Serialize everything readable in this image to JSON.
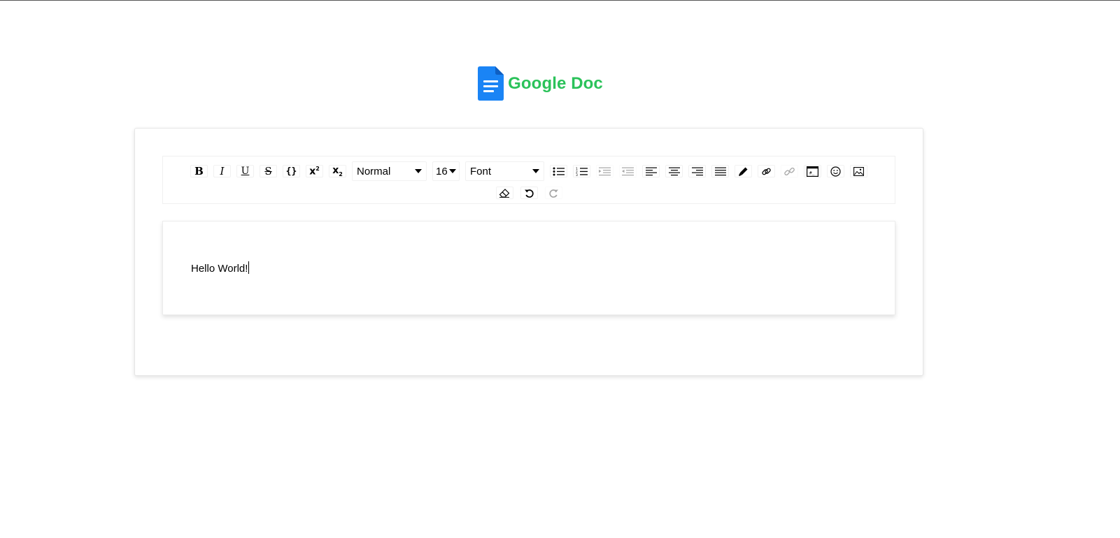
{
  "app": {
    "title": "Google Doc",
    "title_color": "#2bc25a",
    "logo_color": "#1a84f5"
  },
  "toolbar": {
    "buttons_row1_left": [
      {
        "name": "bold-button",
        "icon": "bold-icon",
        "glyph": "B"
      },
      {
        "name": "italic-button",
        "icon": "italic-icon",
        "glyph": "I"
      },
      {
        "name": "underline-button",
        "icon": "underline-icon",
        "glyph": "U"
      },
      {
        "name": "strikethrough-button",
        "icon": "strikethrough-icon",
        "glyph": "S"
      },
      {
        "name": "code-button",
        "icon": "code-braces-icon",
        "glyph": "{ }"
      },
      {
        "name": "superscript-button",
        "icon": "superscript-icon",
        "glyph": "x²"
      },
      {
        "name": "subscript-button",
        "icon": "subscript-icon",
        "glyph": "x₂"
      }
    ],
    "block_type": "Normal",
    "font_size": "16",
    "font_family": "Font",
    "buttons_row1_right": [
      "unordered-list-icon",
      "ordered-list-icon",
      "indent-icon",
      "outdent-icon",
      "align-left-icon",
      "align-center-icon",
      "align-right-icon",
      "align-justify-icon",
      "color-picker-icon",
      "link-icon",
      "unlink-icon",
      "embedded-icon",
      "emoji-icon",
      "image-icon"
    ],
    "buttons_row2": [
      "eraser-icon",
      "undo-icon",
      "redo-icon"
    ]
  },
  "editor": {
    "content": "Hello World!"
  }
}
